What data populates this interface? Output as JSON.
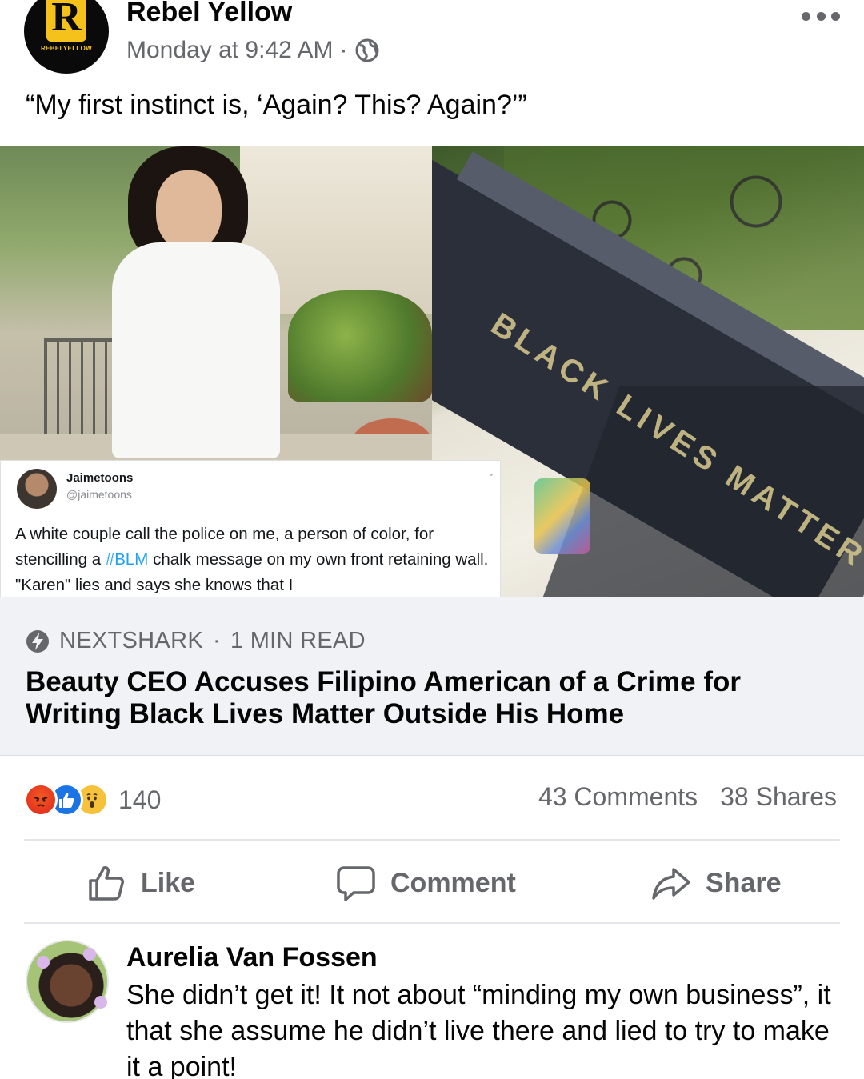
{
  "post": {
    "page_name": "Rebel Yellow",
    "logo_letter": "R",
    "logo_text": "REBELYELLOW",
    "timestamp": "Monday at 9:42 AM",
    "separator": "·",
    "text": "“My first instinct is, ‘Again? This? Again?’”"
  },
  "media": {
    "stencil_text": "BLACK LIVES MATTER",
    "tweet": {
      "name": "Jaimetoons",
      "handle": "@jaimetoons",
      "body_before": "A white couple call the police on me, a person of color, for stencilling a ",
      "hashtag": "#BLM",
      "body_after": " chalk message on my own front retaining wall. \"Karen\" lies and says she knows that I"
    }
  },
  "link": {
    "source": "NEXTSHARK",
    "read_time": "1 MIN READ",
    "separator": "·",
    "title": "Beauty CEO Accuses Filipino American of a Crime for Writing Black Lives Matter Outside His Home"
  },
  "stats": {
    "reaction_count": "140",
    "comments": "43 Comments",
    "shares": "38 Shares"
  },
  "actions": {
    "like": "Like",
    "comment": "Comment",
    "share": "Share"
  },
  "comment": {
    "author": "Aurelia Van Fossen",
    "text": "She didn’t get it! It not about “minding my own business”, it that she assume he didn’t live there and lied to try to make it a point!"
  },
  "colors": {
    "brand_yellow": "#f4c21b",
    "meta_gray": "#65676b",
    "link_bg": "#f0f2f5",
    "hashtag_blue": "#1da1f2",
    "like_blue": "#1b74e4"
  },
  "icons": [
    "globe-icon",
    "more-icon",
    "bolt-icon",
    "angry-reaction-icon",
    "like-reaction-icon",
    "wow-reaction-icon",
    "thumbs-up-icon",
    "comment-bubble-icon",
    "share-arrow-icon"
  ]
}
